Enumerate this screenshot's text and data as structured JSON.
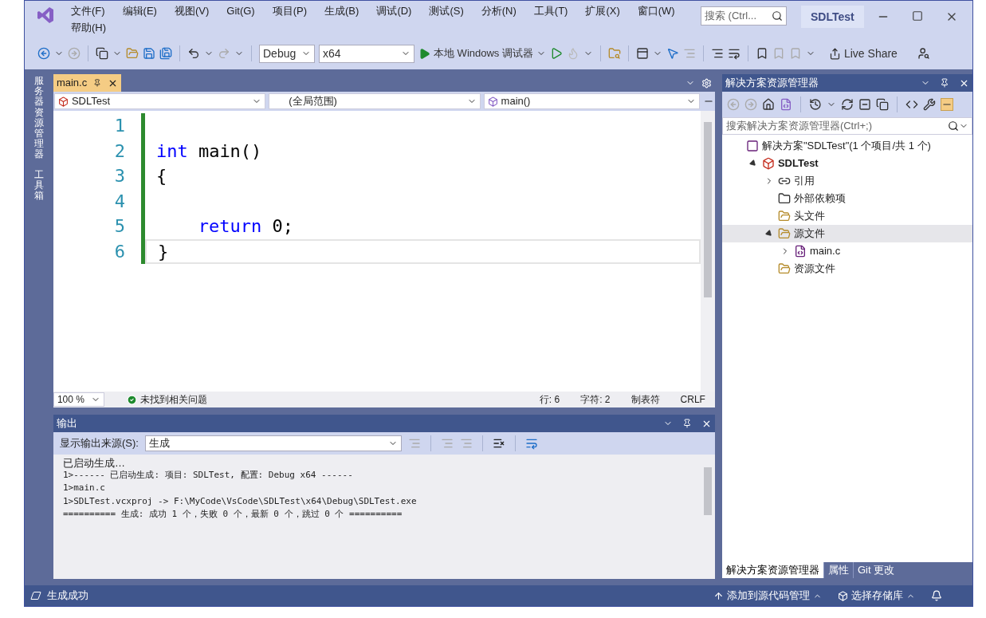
{
  "window": {
    "title": "SDLTest",
    "search_placeholder": "搜索 (Ctrl..."
  },
  "menu": [
    "文件(F)",
    "编辑(E)",
    "视图(V)",
    "Git(G)",
    "项目(P)",
    "生成(B)",
    "调试(D)",
    "测试(S)",
    "分析(N)",
    "工具(T)",
    "扩展(X)",
    "窗口(W)",
    "帮助(H)"
  ],
  "toolbar": {
    "configuration": "Debug",
    "platform": "x64",
    "debug_target": "本地 Windows 调试器",
    "live_share": "Live Share"
  },
  "left_rail": [
    "服务器资源管理器",
    "工具箱"
  ],
  "editor": {
    "tabs": [
      {
        "label": "main.c",
        "selected": true
      }
    ],
    "nav": [
      "SDLTest",
      "(全局范围)",
      "main()"
    ],
    "lines": [
      {
        "number": "1",
        "current": false
      },
      {
        "number": "2",
        "current": false,
        "tokens": [
          {
            "text": "int",
            "kind": "keyword"
          },
          {
            "text": " main()",
            "kind": "plain"
          }
        ]
      },
      {
        "number": "3",
        "current": false,
        "tokens": [
          {
            "text": "{",
            "kind": "plain"
          }
        ]
      },
      {
        "number": "4",
        "current": false
      },
      {
        "number": "5",
        "current": false,
        "tokens": [
          {
            "text": "    return",
            "kind": "keyword"
          },
          {
            "text": " 0;",
            "kind": "plain"
          }
        ]
      },
      {
        "number": "6",
        "current": true,
        "tokens": [
          {
            "text": "}",
            "kind": "plain"
          }
        ]
      }
    ],
    "zoom": "100 %",
    "issues": "未找到相关问题",
    "position": [
      "行: 6",
      "字符: 2",
      "制表符",
      "CRLF"
    ]
  },
  "output": {
    "title": "输出",
    "source_label": "显示输出来源(S):",
    "source": "生成",
    "lines": [
      "已启动生成…",
      "1>------ 已启动生成: 项目: SDLTest, 配置: Debug x64 ------",
      "1>main.c",
      "1>SDLTest.vcxproj -> F:\\MyCode\\VsCode\\SDLTest\\x64\\Debug\\SDLTest.exe",
      "========== 生成: 成功 1 个，失败 0 个，最新 0 个，跳过 0 个 =========="
    ]
  },
  "solution_explorer": {
    "title": "解决方案资源管理器",
    "search_placeholder": "搜索解决方案资源管理器(Ctrl+;)",
    "tree": [
      {
        "label": "解决方案\"SDLTest\"(1 个项目/共 1 个)",
        "kind": "solution",
        "selected": false,
        "children": [
          {
            "label": "SDLTest",
            "kind": "project",
            "expanded": true,
            "selected": false,
            "children": [
              {
                "label": "引用",
                "kind": "references",
                "expanded": false,
                "selected": false
              },
              {
                "label": "外部依赖项",
                "kind": "external",
                "selected": false
              },
              {
                "label": "头文件",
                "kind": "filter",
                "selected": false
              },
              {
                "label": "源文件",
                "kind": "filter",
                "expanded": true,
                "selected": true,
                "children": [
                  {
                    "label": "main.c",
                    "kind": "file",
                    "expanded": false,
                    "selected": false
                  }
                ]
              },
              {
                "label": "资源文件",
                "kind": "filter",
                "selected": false
              }
            ]
          }
        ]
      }
    ],
    "tabs": [
      {
        "label": "解决方案资源管理器",
        "selected": true
      },
      {
        "label": "属性",
        "selected": false
      },
      {
        "label": "Git 更改",
        "selected": false
      }
    ]
  },
  "status_bar": {
    "message": "生成成功",
    "items": [
      "添加到源代码管理",
      "选择存储库"
    ]
  }
}
